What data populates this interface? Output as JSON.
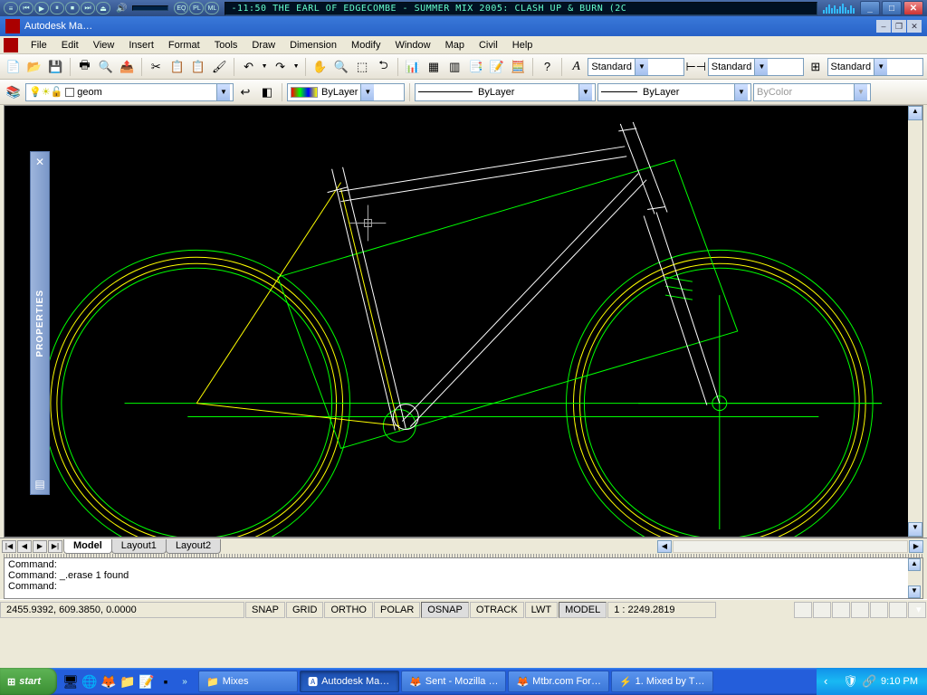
{
  "mediaplayer": {
    "track": "-11:50  THE EARL OF EDGECOMBE - SUMMER MIX 2005: CLASH UP & BURN (2C"
  },
  "app": {
    "title": "Autodesk Ma…"
  },
  "menu": [
    "File",
    "Edit",
    "View",
    "Insert",
    "Format",
    "Tools",
    "Draw",
    "Dimension",
    "Modify",
    "Window",
    "Map",
    "Civil",
    "Help"
  ],
  "styles": {
    "text": "Standard",
    "dim": "Standard",
    "table": "Standard"
  },
  "layer": {
    "current": "geom",
    "color_prop": "ByLayer",
    "linetype": "ByLayer",
    "lineweight": "ByLayer",
    "plotstyle": "ByColor"
  },
  "properties_panel": {
    "label": "PROPERTIES"
  },
  "tabs": {
    "model": "Model",
    "l1": "Layout1",
    "l2": "Layout2"
  },
  "command": {
    "line1": "Command:",
    "line2": "Command: _.erase 1 found",
    "line3": "Command:"
  },
  "status": {
    "coords": "2455.9392, 609.3850, 0.0000",
    "snap": "SNAP",
    "grid": "GRID",
    "ortho": "ORTHO",
    "polar": "POLAR",
    "osnap": "OSNAP",
    "otrack": "OTRACK",
    "lwt": "LWT",
    "model": "MODEL",
    "scale": "1 : 2249.2819"
  },
  "taskbar": {
    "start": "start",
    "tasks": [
      {
        "icon": "📁",
        "label": "Mixes"
      },
      {
        "icon": "🅰",
        "label": "Autodesk Ma…"
      },
      {
        "icon": "🦊",
        "label": "Sent - Mozilla …"
      },
      {
        "icon": "🦊",
        "label": "Mtbr.com For…"
      },
      {
        "icon": "⚡",
        "label": "1. Mixed by T…"
      }
    ],
    "clock": "9:10 PM"
  }
}
